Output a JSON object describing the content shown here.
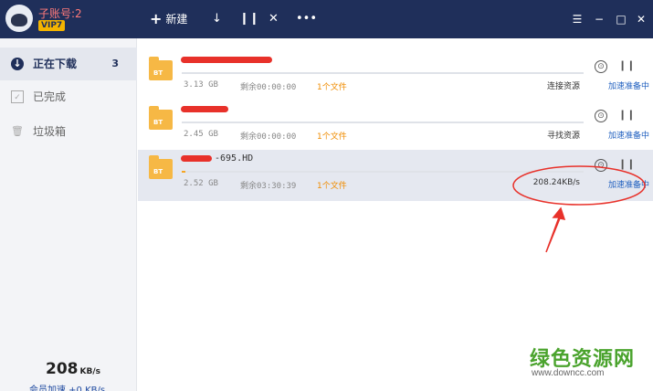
{
  "account": {
    "label": "子账号:2",
    "vip": "VIP7"
  },
  "toolbar": {
    "new_label": "新建",
    "new_icon": "plus-icon",
    "download_icon": "arrow-down-icon",
    "pause_icon": "pause-icon",
    "delete_icon": "close-icon",
    "more_icon": "more-icon"
  },
  "window": {
    "menu": "☰",
    "minimize": "−",
    "maximize": "□",
    "close": "✕"
  },
  "sidebar": {
    "items": [
      {
        "label": "正在下载",
        "count": "3",
        "icon": "download-circle-icon"
      },
      {
        "label": "已完成",
        "count": "",
        "icon": "check-box-icon"
      },
      {
        "label": "垃圾箱",
        "count": "",
        "icon": "trash-icon"
      }
    ],
    "speed_value": "208",
    "speed_unit": "KB/s",
    "vip_speed": "会员加速 +0 KB/s"
  },
  "tasks": [
    {
      "name": "",
      "size": "3.13 GB",
      "remaining": "剩余00:00:00",
      "files": "1个文件",
      "status": "连接资源",
      "accel": "加速准备中",
      "progress": 0
    },
    {
      "name": "",
      "size": "2.45 GB",
      "remaining": "剩余00:00:00",
      "files": "1个文件",
      "status": "寻找资源",
      "accel": "加速准备中",
      "progress": 0
    },
    {
      "name": "-695.HD",
      "size": "2.52 GB",
      "remaining": "剩余03:30:39",
      "files": "1个文件",
      "status": "208.24KB/s",
      "accel": "加速准备中",
      "progress": 0.01
    }
  ],
  "colors": {
    "titlebar": "#1f2f5a",
    "accent_link": "#1f5fbf",
    "files": "#f08c00",
    "annotation": "#e8312a"
  },
  "watermark": {
    "cn": "绿色资源网",
    "url": "www.downcc.com"
  }
}
